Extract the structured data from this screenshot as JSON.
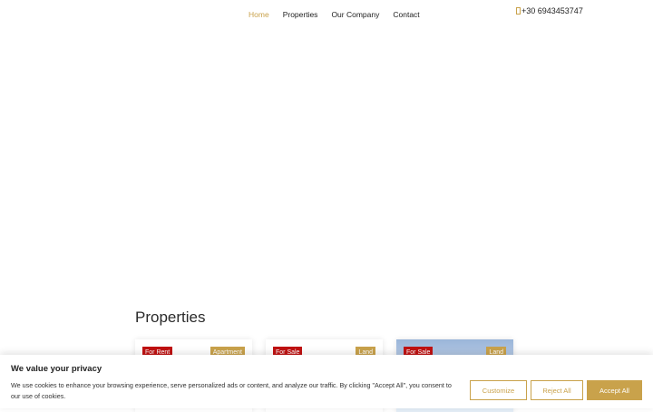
{
  "nav": {
    "items": [
      {
        "label": "Home",
        "active": true
      },
      {
        "label": "Properties",
        "active": false
      },
      {
        "label": "Our Company",
        "active": false
      },
      {
        "label": "Contact",
        "active": false
      }
    ],
    "phone": "+30 6943453747",
    "phone_icon": "phone-icon"
  },
  "colors": {
    "accent": "#c9a24b",
    "badge_red": "#c01212"
  },
  "properties": {
    "title": "Properties",
    "cards": [
      {
        "type": "For Rent",
        "category": "Apartment"
      },
      {
        "type": "For Sale",
        "category": "Land"
      },
      {
        "type": "For Sale",
        "category": "Land"
      }
    ]
  },
  "cookie": {
    "title": "We value your privacy",
    "text": "We use cookies to enhance your browsing experience, serve personalized ads or content, and analyze our traffic. By clicking \"Accept All\", you consent to our use of cookies.",
    "customize": "Customize",
    "reject": "Reject All",
    "accept": "Accept All"
  }
}
